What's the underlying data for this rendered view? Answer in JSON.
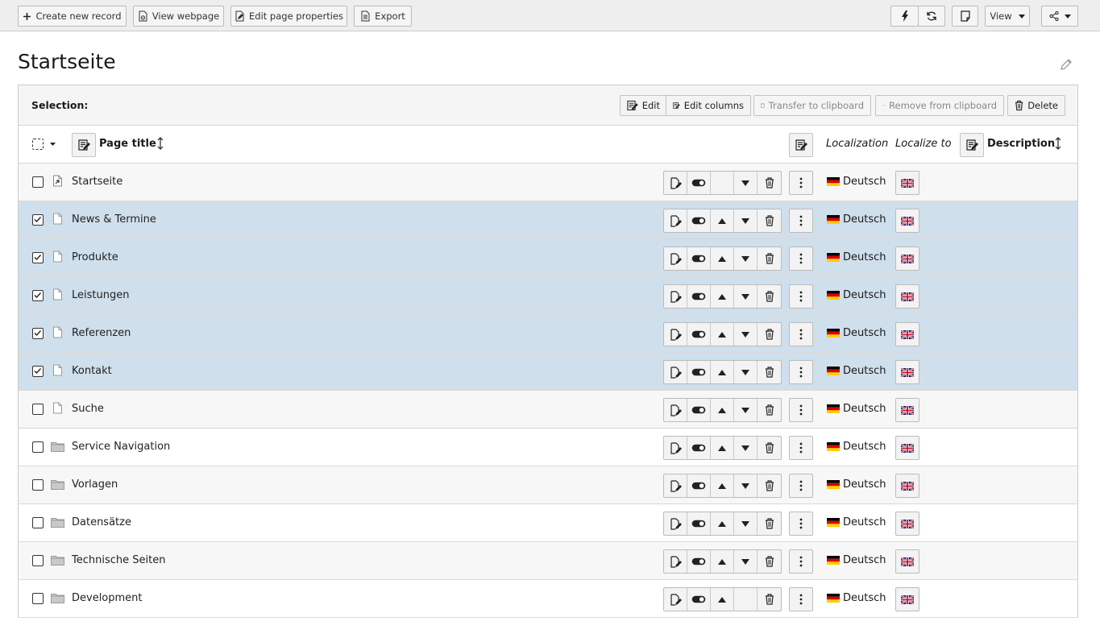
{
  "toolbar": {
    "create_new_record": "Create new record",
    "view_webpage": "View webpage",
    "edit_page_properties": "Edit page properties",
    "export": "Export",
    "view": "View"
  },
  "page": {
    "title": "Startseite"
  },
  "selection": {
    "label": "Selection:",
    "edit": "Edit",
    "edit_columns": "Edit columns",
    "transfer_to_clipboard": "Transfer to clipboard",
    "remove_from_clipboard": "Remove from clipboard",
    "delete": "Delete"
  },
  "columns": {
    "page_title": "Page title",
    "localization": "Localization",
    "localize_to": "Localize to",
    "description": "Description"
  },
  "rows": [
    {
      "title": "Startseite",
      "checked": false,
      "icon": "root-page-icon",
      "localization": "Deutsch",
      "has_up": false,
      "has_down": true
    },
    {
      "title": "News & Termine",
      "checked": true,
      "icon": "page-icon",
      "localization": "Deutsch",
      "has_up": true,
      "has_down": true
    },
    {
      "title": "Produkte",
      "checked": true,
      "icon": "page-icon",
      "localization": "Deutsch",
      "has_up": true,
      "has_down": true
    },
    {
      "title": "Leistungen",
      "checked": true,
      "icon": "page-icon",
      "localization": "Deutsch",
      "has_up": true,
      "has_down": true
    },
    {
      "title": "Referenzen",
      "checked": true,
      "icon": "page-icon",
      "localization": "Deutsch",
      "has_up": true,
      "has_down": true
    },
    {
      "title": "Kontakt",
      "checked": true,
      "icon": "page-icon",
      "localization": "Deutsch",
      "has_up": true,
      "has_down": true
    },
    {
      "title": "Suche",
      "checked": false,
      "icon": "page-icon",
      "localization": "Deutsch",
      "has_up": true,
      "has_down": true
    },
    {
      "title": "Service Navigation",
      "checked": false,
      "icon": "folder-icon",
      "localization": "Deutsch",
      "has_up": true,
      "has_down": true
    },
    {
      "title": "Vorlagen",
      "checked": false,
      "icon": "folder-icon",
      "localization": "Deutsch",
      "has_up": true,
      "has_down": true
    },
    {
      "title": "Datensätze",
      "checked": false,
      "icon": "folder-icon",
      "localization": "Deutsch",
      "has_up": true,
      "has_down": true
    },
    {
      "title": "Technische Seiten",
      "checked": false,
      "icon": "folder-icon",
      "localization": "Deutsch",
      "has_up": true,
      "has_down": true
    },
    {
      "title": "Development",
      "checked": false,
      "icon": "folder-icon",
      "localization": "Deutsch",
      "has_up": true,
      "has_down": false
    }
  ],
  "colors": {
    "selected_row": "#cfdfec",
    "toolbar_bg": "#eeeeee"
  }
}
